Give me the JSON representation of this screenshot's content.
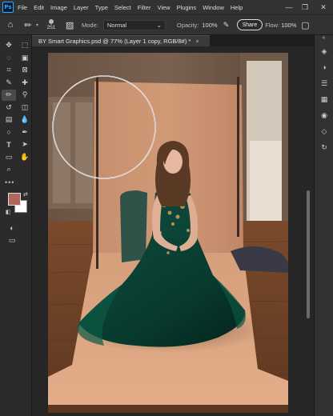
{
  "menubar": {
    "logo": "Ps",
    "items": [
      "File",
      "Edit",
      "Image",
      "Layer",
      "Type",
      "Select",
      "Filter",
      "View",
      "Plugins",
      "Window",
      "Help"
    ],
    "minimize": "—",
    "restore": "❐",
    "close": "✕"
  },
  "options": {
    "brush_size": "251",
    "mode_label": "Mode:",
    "mode_value": "Normal",
    "opacity_label": "Opacity:",
    "opacity_value": "100%",
    "share_label": "Share",
    "flow_label": "Flow:",
    "flow_value": "100%"
  },
  "document": {
    "tab_title": "BY Smart Graphics.psd @ 77% (Layer 1 copy, RGB/8#) *",
    "close_glyph": "×"
  },
  "tools": [
    {
      "name": "move-tool",
      "glyph": "✥"
    },
    {
      "name": "marquee-tool",
      "glyph": "⬚"
    },
    {
      "name": "lasso-tool",
      "glyph": "◌"
    },
    {
      "name": "object-select-tool",
      "glyph": "▣"
    },
    {
      "name": "crop-tool",
      "glyph": "⌗"
    },
    {
      "name": "frame-tool",
      "glyph": "⊠"
    },
    {
      "name": "eyedropper-tool",
      "glyph": "✎"
    },
    {
      "name": "healing-tool",
      "glyph": "✚"
    },
    {
      "name": "brush-tool",
      "glyph": "✏"
    },
    {
      "name": "stamp-tool",
      "glyph": "⚲"
    },
    {
      "name": "history-brush-tool",
      "glyph": "↺"
    },
    {
      "name": "eraser-tool",
      "glyph": "◫"
    },
    {
      "name": "gradient-tool",
      "glyph": "▤"
    },
    {
      "name": "blur-tool",
      "glyph": "💧"
    },
    {
      "name": "dodge-tool",
      "glyph": "○"
    },
    {
      "name": "pen-tool",
      "glyph": "✒"
    },
    {
      "name": "type-tool",
      "glyph": "T"
    },
    {
      "name": "path-select-tool",
      "glyph": "➤"
    },
    {
      "name": "shape-tool",
      "glyph": "▭"
    },
    {
      "name": "hand-tool",
      "glyph": "✋"
    },
    {
      "name": "zoom-tool",
      "glyph": "⌕"
    }
  ],
  "more_tools": "•••",
  "colors": {
    "foreground": "#b0675a",
    "background": "#ffffff",
    "accent": "#31a8ff"
  },
  "right_panel": [
    "layers-icon",
    "adjustments-icon",
    "properties-icon",
    "libraries-icon",
    "channels-icon",
    "paths-icon",
    "history-icon"
  ]
}
